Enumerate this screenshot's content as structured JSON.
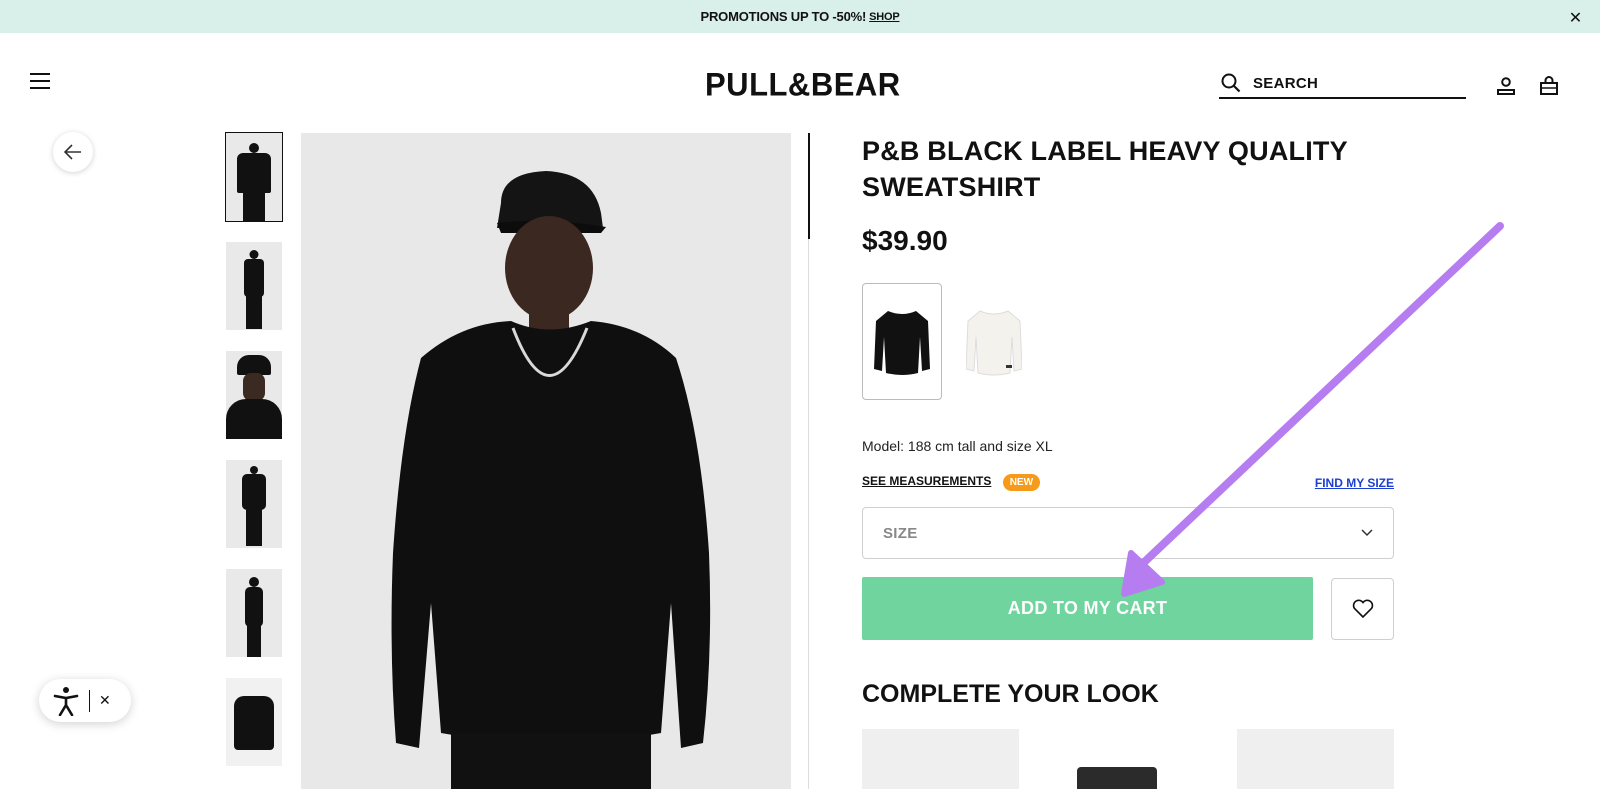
{
  "promo": {
    "text": "PROMOTIONS UP TO -50%!",
    "link": "SHOP"
  },
  "header": {
    "logo": "PULL&BEAR",
    "search_label": "SEARCH"
  },
  "product": {
    "title": "P&B BLACK LABEL HEAVY QUALITY SWEATSHIRT",
    "price": "$39.90",
    "model_info": "Model: 188 cm tall and size XL",
    "see_measurements": "SEE MEASUREMENTS",
    "new_badge": "NEW",
    "find_size": "FIND MY SIZE",
    "size_placeholder": "SIZE",
    "add_to_cart": "ADD TO MY CART",
    "complete_look": "COMPLETE YOUR LOOK"
  },
  "colors": {
    "promo_bg": "#d9efe9",
    "cart_button": "#6fd49e",
    "badge": "#f59a1a",
    "link_blue": "#1b3fd1",
    "annotation_arrow": "#b57df0"
  },
  "icons": [
    "menu-icon",
    "search-icon",
    "user-icon",
    "bag-icon",
    "arrow-left-icon",
    "chevron-down-icon",
    "heart-icon",
    "accessibility-icon",
    "close-icon"
  ]
}
